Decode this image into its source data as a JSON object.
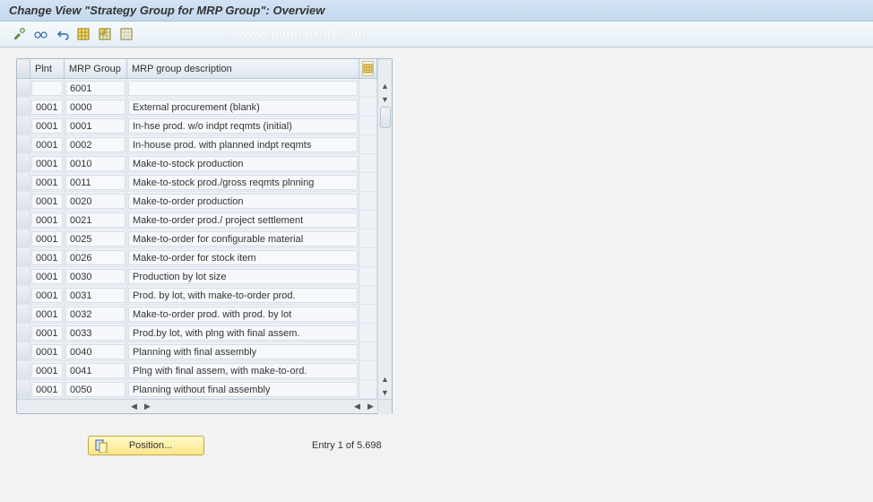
{
  "title": "Change View \"Strategy Group for MRP Group\": Overview",
  "watermark": "© www.tutorialkart.com",
  "columns": {
    "plnt": "Plnt",
    "group": "MRP Group",
    "desc": "MRP group description"
  },
  "rows": [
    {
      "plnt": "",
      "group": "6001",
      "desc": ""
    },
    {
      "plnt": "0001",
      "group": "0000",
      "desc": "External procurement            (blank)"
    },
    {
      "plnt": "0001",
      "group": "0001",
      "desc": "In-hse prod. w/o indpt reqmts (initial)"
    },
    {
      "plnt": "0001",
      "group": "0002",
      "desc": "In-house prod. with planned indpt reqmts"
    },
    {
      "plnt": "0001",
      "group": "0010",
      "desc": "Make-to-stock production"
    },
    {
      "plnt": "0001",
      "group": "0011",
      "desc": "Make-to-stock prod./gross reqmts plnning"
    },
    {
      "plnt": "0001",
      "group": "0020",
      "desc": "Make-to-order production"
    },
    {
      "plnt": "0001",
      "group": "0021",
      "desc": "Make-to-order prod./ project settlement"
    },
    {
      "plnt": "0001",
      "group": "0025",
      "desc": "Make-to-order for configurable material"
    },
    {
      "plnt": "0001",
      "group": "0026",
      "desc": "Make-to-order for stock item"
    },
    {
      "plnt": "0001",
      "group": "0030",
      "desc": "Production by lot size"
    },
    {
      "plnt": "0001",
      "group": "0031",
      "desc": "Prod. by lot, with make-to-order prod."
    },
    {
      "plnt": "0001",
      "group": "0032",
      "desc": "Make-to-order prod. with prod. by lot"
    },
    {
      "plnt": "0001",
      "group": "0033",
      "desc": "Prod.by lot, with plng with final assem."
    },
    {
      "plnt": "0001",
      "group": "0040",
      "desc": "Planning with final assembly"
    },
    {
      "plnt": "0001",
      "group": "0041",
      "desc": "Plng with final assem, with make-to-ord."
    },
    {
      "plnt": "0001",
      "group": "0050",
      "desc": "Planning without final assembly"
    }
  ],
  "footer": {
    "position_label": "Position...",
    "entry_text": "Entry 1 of 5.698"
  }
}
